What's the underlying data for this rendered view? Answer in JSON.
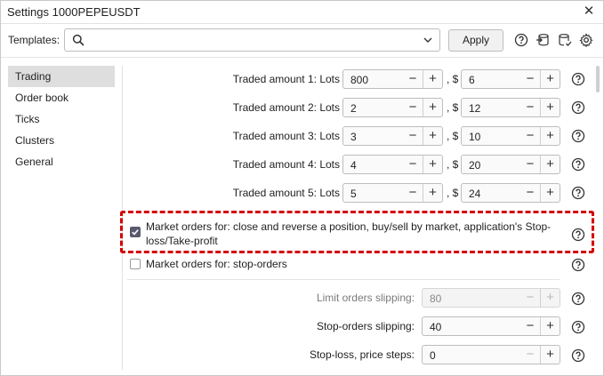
{
  "window": {
    "title": "Settings 1000PEPEUSDT"
  },
  "templates": {
    "label": "Templates:",
    "value": "",
    "apply_label": "Apply"
  },
  "sidebar": {
    "items": [
      {
        "label": "Trading",
        "active": true
      },
      {
        "label": "Order book"
      },
      {
        "label": "Ticks"
      },
      {
        "label": "Clusters"
      },
      {
        "label": "General"
      }
    ]
  },
  "traded_amounts": [
    {
      "label": "Traded amount 1: Lots",
      "lots": "800",
      "sep": ", $",
      "usd": "6"
    },
    {
      "label": "Traded amount 2: Lots",
      "lots": "2",
      "sep": ", $",
      "usd": "12"
    },
    {
      "label": "Traded amount 3: Lots",
      "lots": "3",
      "sep": ", $",
      "usd": "10"
    },
    {
      "label": "Traded amount 4: Lots",
      "lots": "4",
      "sep": ", $",
      "usd": "20"
    },
    {
      "label": "Traded amount 5: Lots",
      "lots": "5",
      "sep": ", $",
      "usd": "24"
    }
  ],
  "market_orders_close": {
    "label": "Market orders for: close and reverse a position, buy/sell by market, application's Stop-loss/Take-profit",
    "checked": true
  },
  "market_orders_stop": {
    "label": "Market orders for: stop-orders",
    "checked": false
  },
  "limit_slipping": {
    "label": "Limit orders slipping:",
    "value": "80",
    "enabled": false
  },
  "stop_slipping": {
    "label": "Stop-orders slipping:",
    "value": "40",
    "enabled": true
  },
  "sl_steps": {
    "label": "Stop-loss, price steps:",
    "value": "0",
    "enabled": true
  },
  "stepper": {
    "minus": "−",
    "plus": "+"
  },
  "colors": {
    "highlight": "#d50000",
    "checkbox_fill": "#5a5a6e",
    "active_tab_bg": "#dedede"
  }
}
